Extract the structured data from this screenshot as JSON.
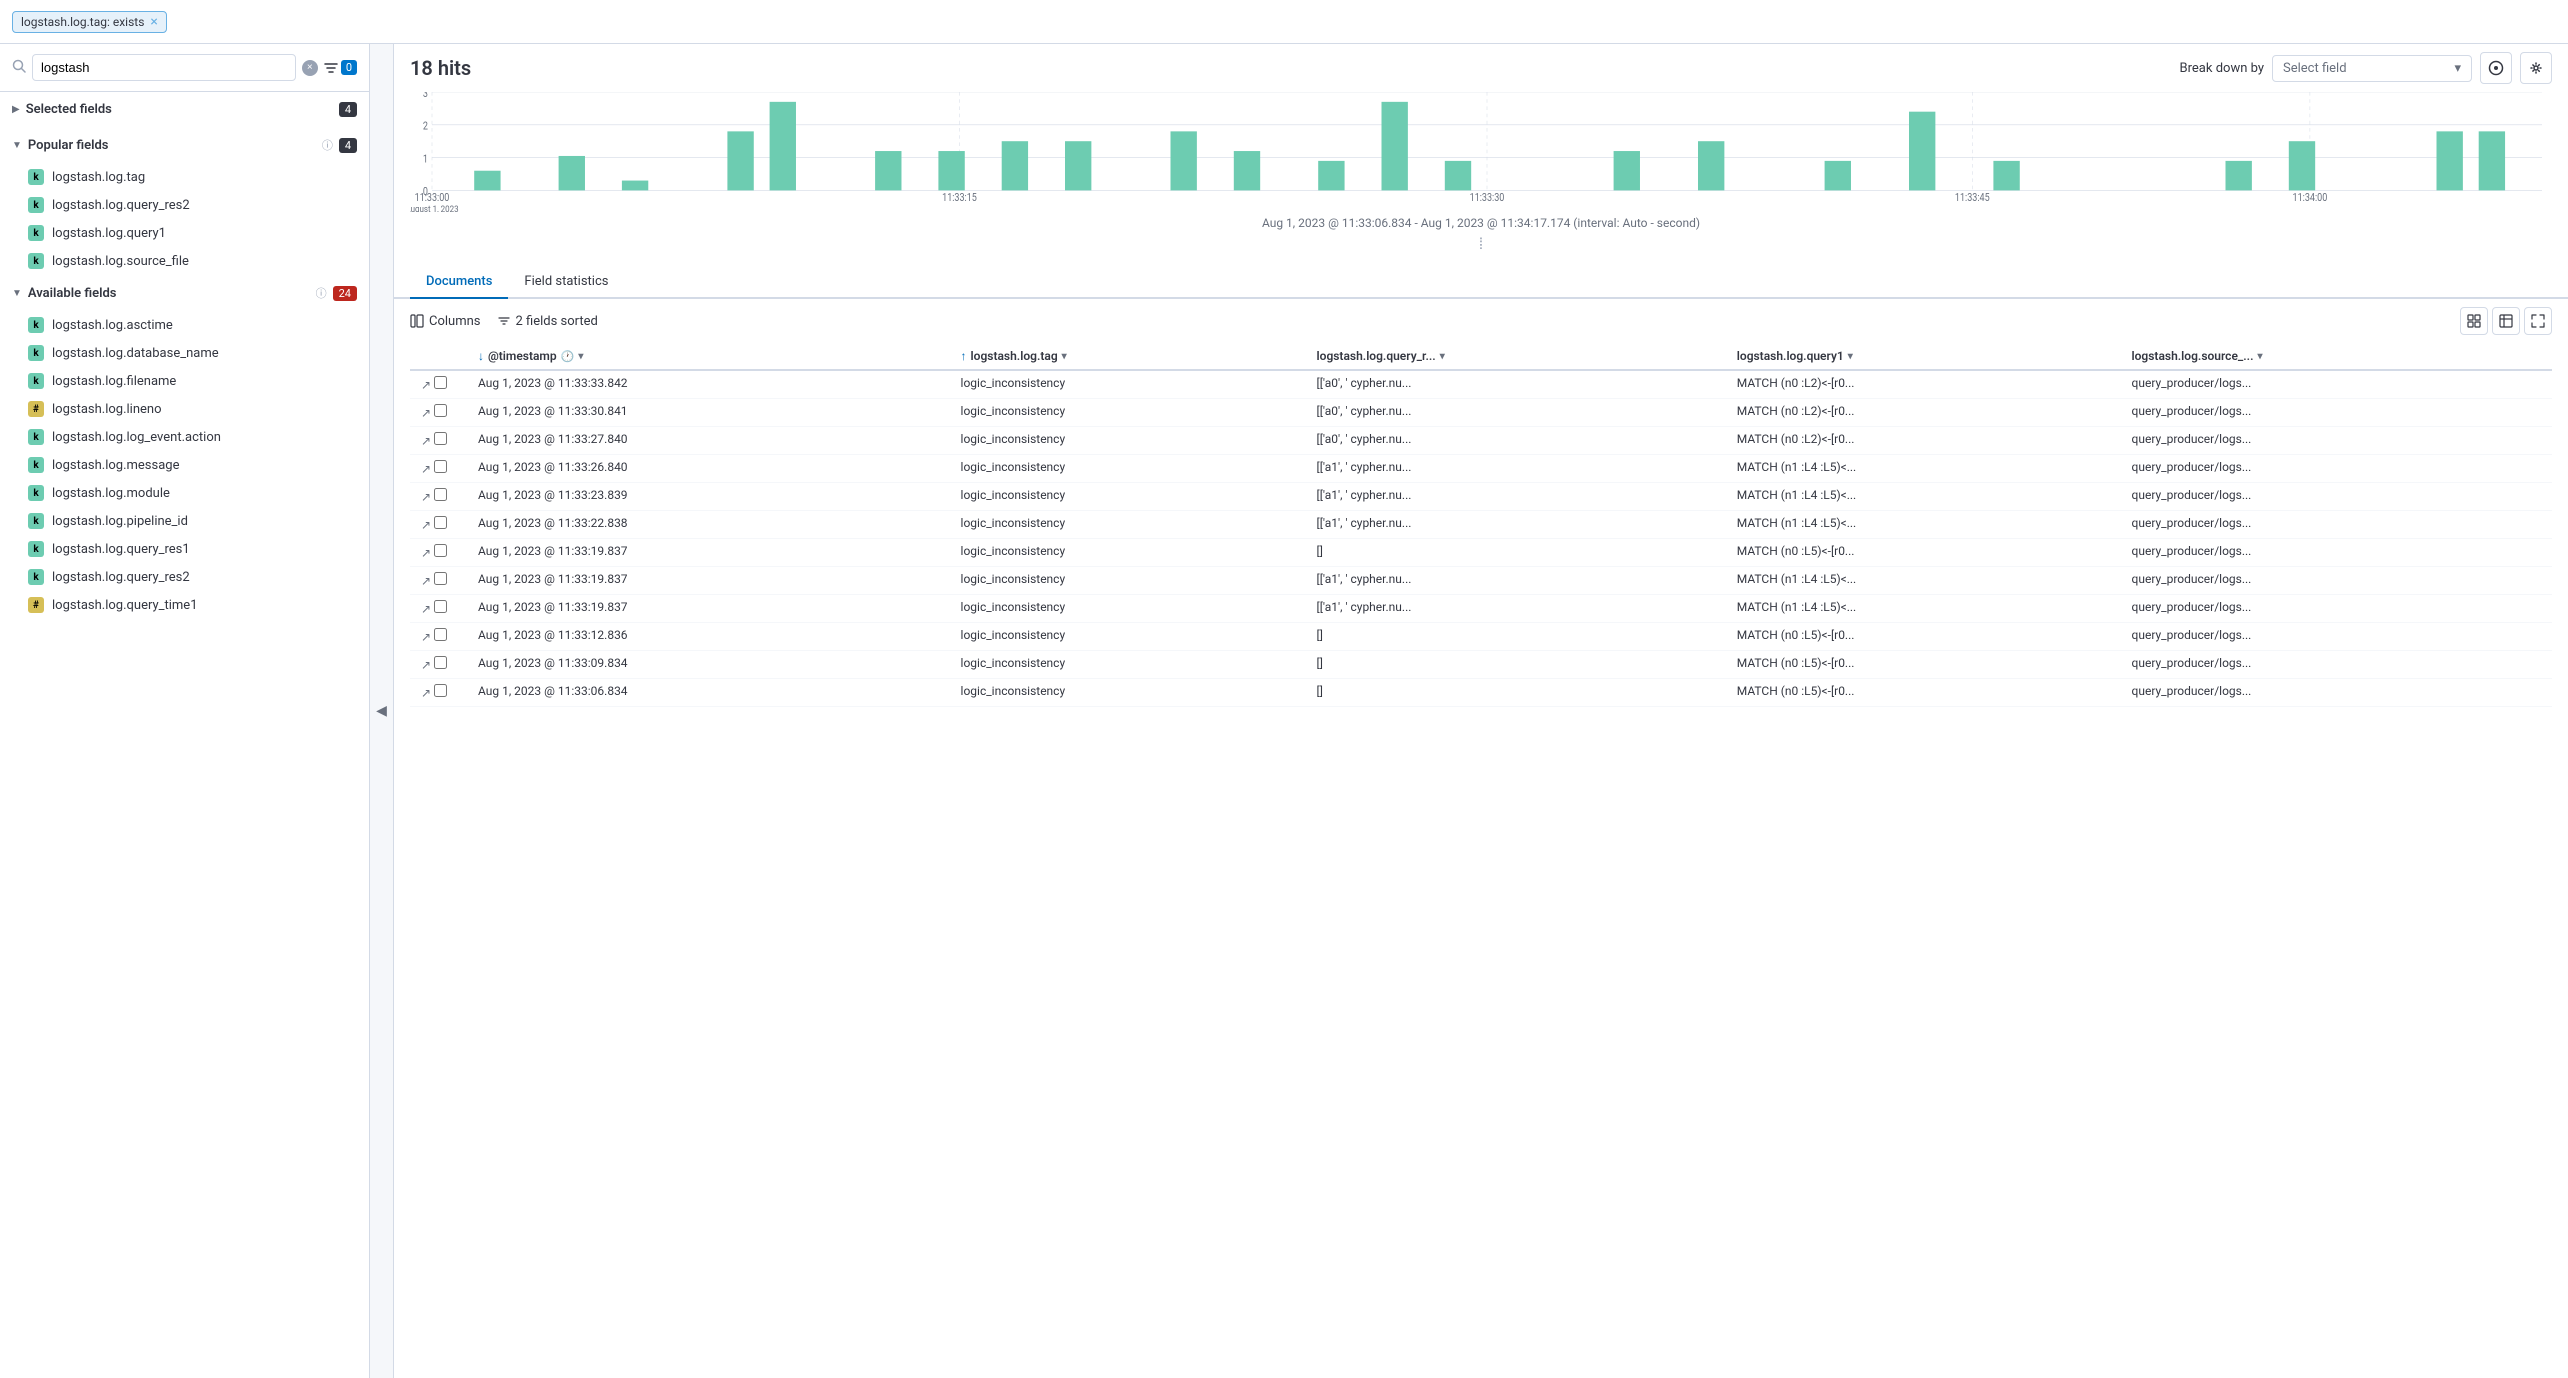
{
  "topbar": {
    "filter_tag": "logstash.log.tag: exists",
    "close_label": "×"
  },
  "sidebar": {
    "search_placeholder": "logstash",
    "search_value": "logstash",
    "filter_count": "0",
    "selected_fields": {
      "title": "Selected fields",
      "count": 4,
      "expanded": false
    },
    "popular_fields": {
      "title": "Popular fields",
      "count": 4,
      "expanded": true,
      "help": "?",
      "fields": [
        {
          "type": "k",
          "name": "logstash.log.tag"
        },
        {
          "type": "k",
          "name": "logstash.log.query_res2"
        },
        {
          "type": "k",
          "name": "logstash.log.query1"
        },
        {
          "type": "k",
          "name": "logstash.log.source_file"
        }
      ]
    },
    "available_fields": {
      "title": "Available fields",
      "count": 24,
      "expanded": true,
      "help": "?",
      "fields": [
        {
          "type": "k",
          "name": "logstash.log.asctime"
        },
        {
          "type": "k",
          "name": "logstash.log.database_name"
        },
        {
          "type": "k",
          "name": "logstash.log.filename"
        },
        {
          "type": "hash",
          "name": "logstash.log.lineno"
        },
        {
          "type": "k",
          "name": "logstash.log.log_event.action"
        },
        {
          "type": "k",
          "name": "logstash.log.message"
        },
        {
          "type": "k",
          "name": "logstash.log.module"
        },
        {
          "type": "k",
          "name": "logstash.log.pipeline_id"
        },
        {
          "type": "k",
          "name": "logstash.log.query_res1"
        },
        {
          "type": "k",
          "name": "logstash.log.query_res2"
        },
        {
          "type": "hash",
          "name": "logstash.log.query_time1"
        }
      ]
    }
  },
  "main": {
    "hits": "18 hits",
    "break_down_label": "Break down by",
    "select_field_placeholder": "Select field",
    "time_range": "Aug 1, 2023 @ 11:33:06.834 - Aug 1, 2023 @ 11:34:17.174 (interval: Auto - second)",
    "chart": {
      "y_labels": [
        "3",
        "2",
        "1",
        "0"
      ],
      "x_labels": [
        "11:33:00\nAugust 1, 2023",
        "11:33:15",
        "11:33:30",
        "11:33:45",
        "11:34:00"
      ],
      "bars": [
        {
          "x": 0.02,
          "h": 0.2,
          "color": "#6dccb1"
        },
        {
          "x": 0.06,
          "h": 0.35,
          "color": "#6dccb1"
        },
        {
          "x": 0.09,
          "h": 0.1,
          "color": "#6dccb1"
        },
        {
          "x": 0.14,
          "h": 0.6,
          "color": "#6dccb1"
        },
        {
          "x": 0.16,
          "h": 0.9,
          "color": "#6dccb1"
        },
        {
          "x": 0.21,
          "h": 0.4,
          "color": "#6dccb1"
        },
        {
          "x": 0.24,
          "h": 0.4,
          "color": "#6dccb1"
        },
        {
          "x": 0.27,
          "h": 0.5,
          "color": "#6dccb1"
        },
        {
          "x": 0.3,
          "h": 0.5,
          "color": "#6dccb1"
        },
        {
          "x": 0.35,
          "h": 0.6,
          "color": "#6dccb1"
        },
        {
          "x": 0.38,
          "h": 0.4,
          "color": "#6dccb1"
        },
        {
          "x": 0.42,
          "h": 0.3,
          "color": "#6dccb1"
        },
        {
          "x": 0.45,
          "h": 0.9,
          "color": "#6dccb1"
        },
        {
          "x": 0.48,
          "h": 0.3,
          "color": "#6dccb1"
        },
        {
          "x": 0.56,
          "h": 0.4,
          "color": "#6dccb1"
        },
        {
          "x": 0.6,
          "h": 0.5,
          "color": "#6dccb1"
        },
        {
          "x": 0.66,
          "h": 0.3,
          "color": "#6dccb1"
        },
        {
          "x": 0.7,
          "h": 0.8,
          "color": "#6dccb1"
        },
        {
          "x": 0.74,
          "h": 0.3,
          "color": "#6dccb1"
        },
        {
          "x": 0.85,
          "h": 0.3,
          "color": "#6dccb1"
        },
        {
          "x": 0.88,
          "h": 0.5,
          "color": "#6dccb1"
        },
        {
          "x": 0.95,
          "h": 0.6,
          "color": "#6dccb1"
        },
        {
          "x": 0.97,
          "h": 0.6,
          "color": "#6dccb1"
        }
      ]
    },
    "tabs": [
      {
        "id": "documents",
        "label": "Documents",
        "active": true
      },
      {
        "id": "field-statistics",
        "label": "Field statistics",
        "active": false
      }
    ],
    "toolbar": {
      "columns_label": "Columns",
      "sorted_label": "2 fields sorted"
    },
    "table": {
      "columns": [
        {
          "id": "timestamp",
          "label": "@timestamp",
          "sort": "down",
          "has_clock": true
        },
        {
          "id": "tag",
          "label": "logstash.log.tag",
          "sort": "up"
        },
        {
          "id": "query_res2",
          "label": "logstash.log.query_r..."
        },
        {
          "id": "query1",
          "label": "logstash.log.query1"
        },
        {
          "id": "source_file",
          "label": "logstash.log.source_..."
        }
      ],
      "rows": [
        {
          "timestamp": "Aug 1, 2023 @ 11:33:33.842",
          "tag": "logic_inconsistency",
          "query_res2": "[['a0', ' cypher.nu...",
          "query1": "MATCH (n0 :L2)<-[r0...",
          "source_file": "query_producer/logs..."
        },
        {
          "timestamp": "Aug 1, 2023 @ 11:33:30.841",
          "tag": "logic_inconsistency",
          "query_res2": "[['a0', ' cypher.nu...",
          "query1": "MATCH (n0 :L2)<-[r0...",
          "source_file": "query_producer/logs..."
        },
        {
          "timestamp": "Aug 1, 2023 @ 11:33:27.840",
          "tag": "logic_inconsistency",
          "query_res2": "[['a0', ' cypher.nu...",
          "query1": "MATCH (n0 :L2)<-[r0...",
          "source_file": "query_producer/logs..."
        },
        {
          "timestamp": "Aug 1, 2023 @ 11:33:26.840",
          "tag": "logic_inconsistency",
          "query_res2": "[['a1', ' cypher.nu...",
          "query1": "MATCH (n1 :L4 :L5)<...",
          "source_file": "query_producer/logs..."
        },
        {
          "timestamp": "Aug 1, 2023 @ 11:33:23.839",
          "tag": "logic_inconsistency",
          "query_res2": "[['a1', ' cypher.nu...",
          "query1": "MATCH (n1 :L4 :L5)<...",
          "source_file": "query_producer/logs..."
        },
        {
          "timestamp": "Aug 1, 2023 @ 11:33:22.838",
          "tag": "logic_inconsistency",
          "query_res2": "[['a1', ' cypher.nu...",
          "query1": "MATCH (n1 :L4 :L5)<...",
          "source_file": "query_producer/logs..."
        },
        {
          "timestamp": "Aug 1, 2023 @ 11:33:19.837",
          "tag": "logic_inconsistency",
          "query_res2": "[]",
          "query1": "MATCH (n0 :L5)<-[r0...",
          "source_file": "query_producer/logs..."
        },
        {
          "timestamp": "Aug 1, 2023 @ 11:33:19.837",
          "tag": "logic_inconsistency",
          "query_res2": "[['a1', ' cypher.nu...",
          "query1": "MATCH (n1 :L4 :L5)<...",
          "source_file": "query_producer/logs..."
        },
        {
          "timestamp": "Aug 1, 2023 @ 11:33:19.837",
          "tag": "logic_inconsistency",
          "query_res2": "[['a1', ' cypher.nu...",
          "query1": "MATCH (n1 :L4 :L5)<...",
          "source_file": "query_producer/logs..."
        },
        {
          "timestamp": "Aug 1, 2023 @ 11:33:12.836",
          "tag": "logic_inconsistency",
          "query_res2": "[]",
          "query1": "MATCH (n0 :L5)<-[r0...",
          "source_file": "query_producer/logs..."
        },
        {
          "timestamp": "Aug 1, 2023 @ 11:33:09.834",
          "tag": "logic_inconsistency",
          "query_res2": "[]",
          "query1": "MATCH (n0 :L5)<-[r0...",
          "source_file": "query_producer/logs..."
        },
        {
          "timestamp": "Aug 1, 2023 @ 11:33:06.834",
          "tag": "logic_inconsistency",
          "query_res2": "[]",
          "query1": "MATCH (n0 :L5)<-[r0...",
          "source_file": "query_producer/logs..."
        }
      ]
    }
  }
}
